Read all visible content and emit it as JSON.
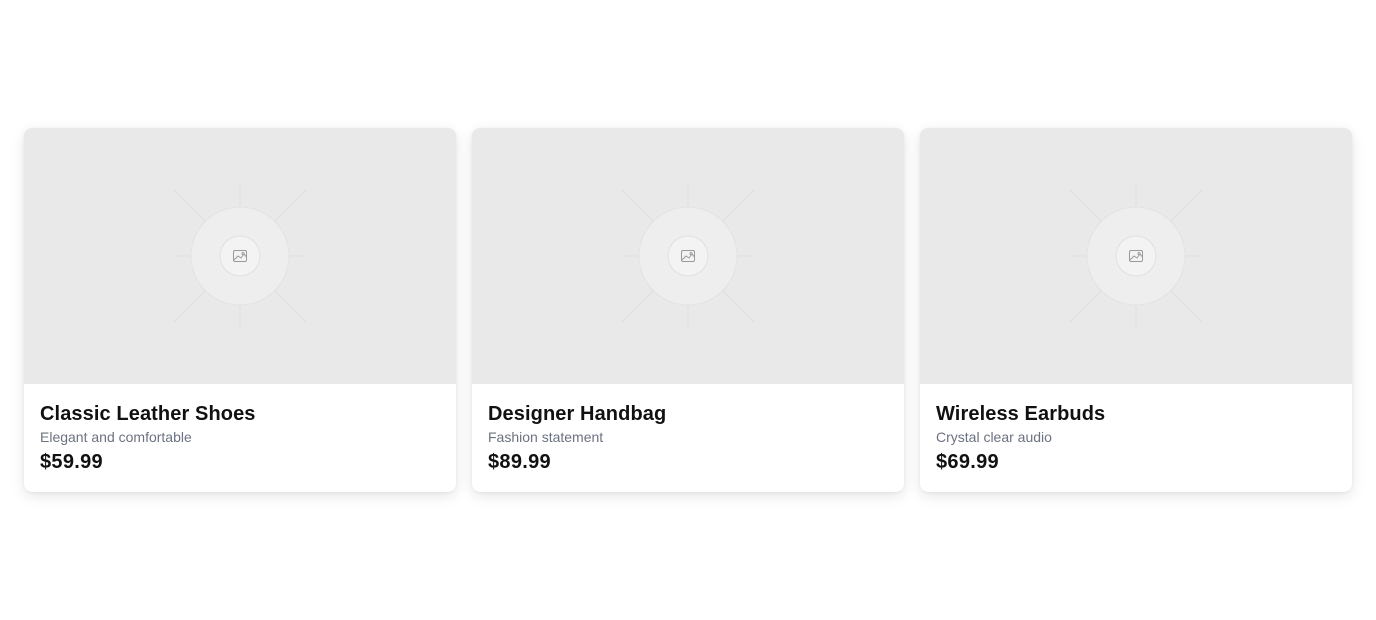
{
  "products": [
    {
      "title": "Classic Leather Shoes",
      "description": "Elegant and comfortable",
      "price": "$59.99",
      "image_icon": "image-placeholder-icon"
    },
    {
      "title": "Designer Handbag",
      "description": "Fashion statement",
      "price": "$89.99",
      "image_icon": "image-placeholder-icon"
    },
    {
      "title": "Wireless Earbuds",
      "description": "Crystal clear audio",
      "price": "$69.99",
      "image_icon": "image-placeholder-icon"
    }
  ],
  "colors": {
    "page_background": "#ffffff",
    "image_placeholder": "#e9e9e9",
    "title_text": "#111111",
    "description_text": "#6b7280"
  }
}
